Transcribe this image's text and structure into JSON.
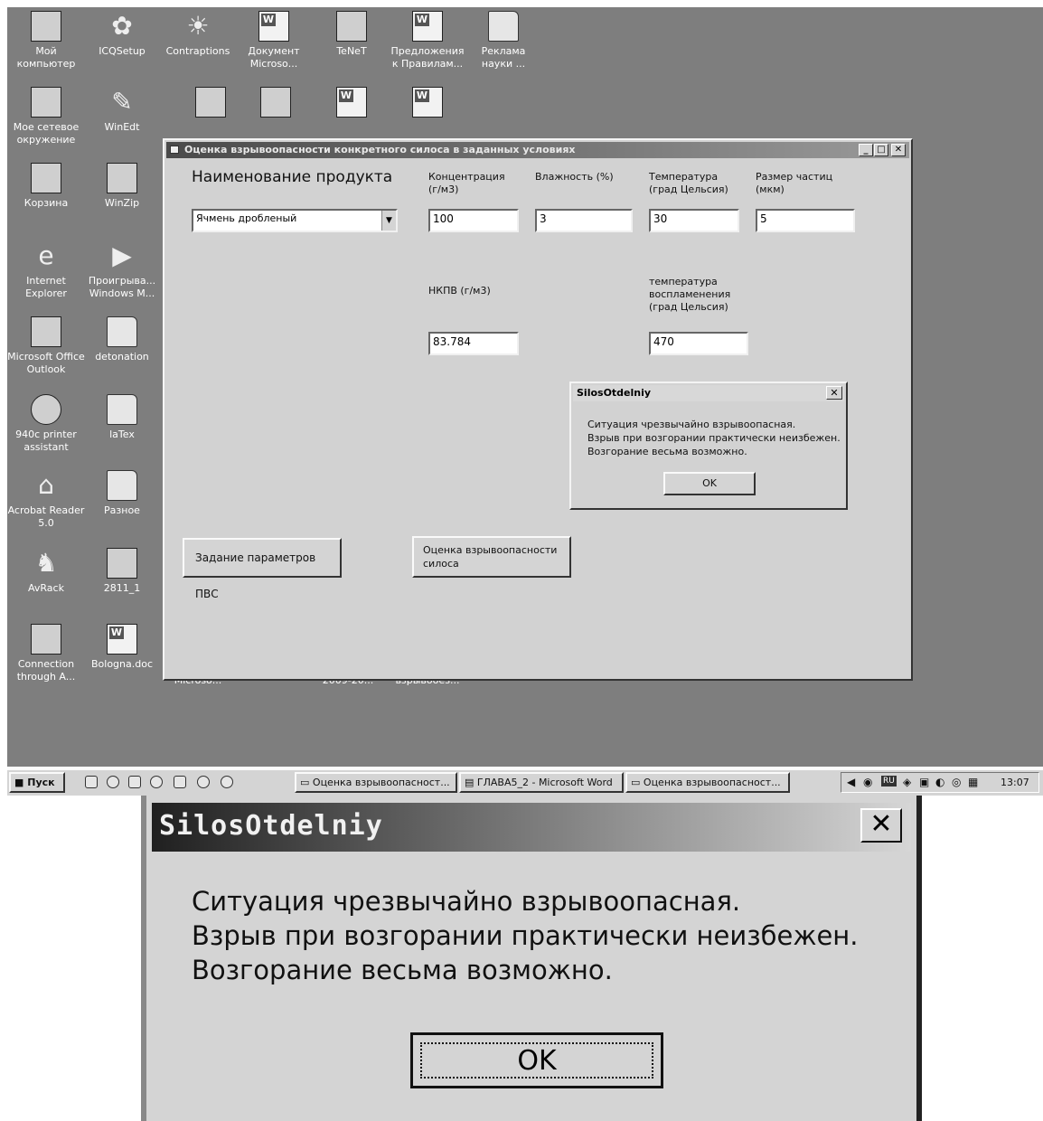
{
  "desktop": {
    "icons": [
      {
        "label": "Мой компьютер",
        "icon": "my-computer-icon"
      },
      {
        "label": "ICQSetup",
        "icon": "icq-icon"
      },
      {
        "label": "Contraptions",
        "icon": "contraptions-icon"
      },
      {
        "label": "Документ Microsо...",
        "icon": "word-doc-icon"
      },
      {
        "label": "TeNeT",
        "icon": "network-icon"
      },
      {
        "label": "Предложения к Правилам...",
        "icon": "word-doc-icon"
      },
      {
        "label": "Реклама науки ...",
        "icon": "folder-icon"
      },
      {
        "label": "Мое сетевое окружение",
        "icon": "network-places-icon"
      },
      {
        "label": "WinEdt",
        "icon": "winedt-icon"
      },
      {
        "label": "Корзина",
        "icon": "recycle-bin-icon"
      },
      {
        "label": "WinZip",
        "icon": "winzip-icon"
      },
      {
        "label": "Internet Explorer",
        "icon": "ie-icon"
      },
      {
        "label": "Проигрыва... Windows M...",
        "icon": "media-player-icon"
      },
      {
        "label": "Microsoft Office Outlook",
        "icon": "outlook-icon"
      },
      {
        "label": "detonation",
        "icon": "folder-icon"
      },
      {
        "label": "940c printer assistant",
        "icon": "hp-icon"
      },
      {
        "label": "laTex",
        "icon": "folder-icon"
      },
      {
        "label": "Acrobat Reader 5.0",
        "icon": "acrobat-icon"
      },
      {
        "label": "Разное",
        "icon": "folder-icon"
      },
      {
        "label": "AvRack",
        "icon": "avrack-icon"
      },
      {
        "label": "2811_1",
        "icon": "media-file-icon"
      },
      {
        "label": "Connection through A...",
        "icon": "connection-icon"
      },
      {
        "label": "Bologna.doc",
        "icon": "word-doc-icon"
      }
    ],
    "hidden_labels": [
      "Microsо...",
      "2009-20...",
      "взрывобез..."
    ]
  },
  "window": {
    "title": "Оценка взрывоопасности конкретного силоса в заданных условиях",
    "product_label": "Наименование продукта",
    "product_value": "Ячмень дробленый",
    "concentration_label": "Концентрация (г/м3)",
    "concentration_value": "100",
    "humidity_label": "Влажность (%)",
    "humidity_value": "3",
    "temperature_label": "Температура (град Цельсия)",
    "temperature_value": "30",
    "particle_label": "Размер частиц (мкм)",
    "particle_value": "5",
    "nkpv_label": "НКПВ (г/м3)",
    "nkpv_value": "83.784",
    "ignition_label": "температура воспламенения (град Цельсия)",
    "ignition_value": "470",
    "params_button": "Задание параметров ПВС",
    "assess_button": "Оценка взрывоопасности силоса"
  },
  "dialog": {
    "title": "SilosOtdelniy",
    "line1": "Ситуация чрезвычайно взрывоопасная.",
    "line2": "Взрыв при возгорании практически неизбежен.",
    "line3": "Возгорание весьма возможно.",
    "ok": "OK"
  },
  "taskbar": {
    "start": "Пуск",
    "items": [
      "Оценка взрывоопаснoст...",
      "ГЛАВА5_2 - Microsoft Word",
      "Оценка взрывоопасност..."
    ],
    "lang": "RU",
    "clock": "13:07"
  },
  "zoom_dialog": {
    "title": "SilosOtdelniy",
    "line1": "Ситуация чрезвычайно взрывоопасная.",
    "line2": "Взрыв при возгорании практически неизбежен.",
    "line3": "Возгорание весьма возможно.",
    "ok": "OK"
  }
}
